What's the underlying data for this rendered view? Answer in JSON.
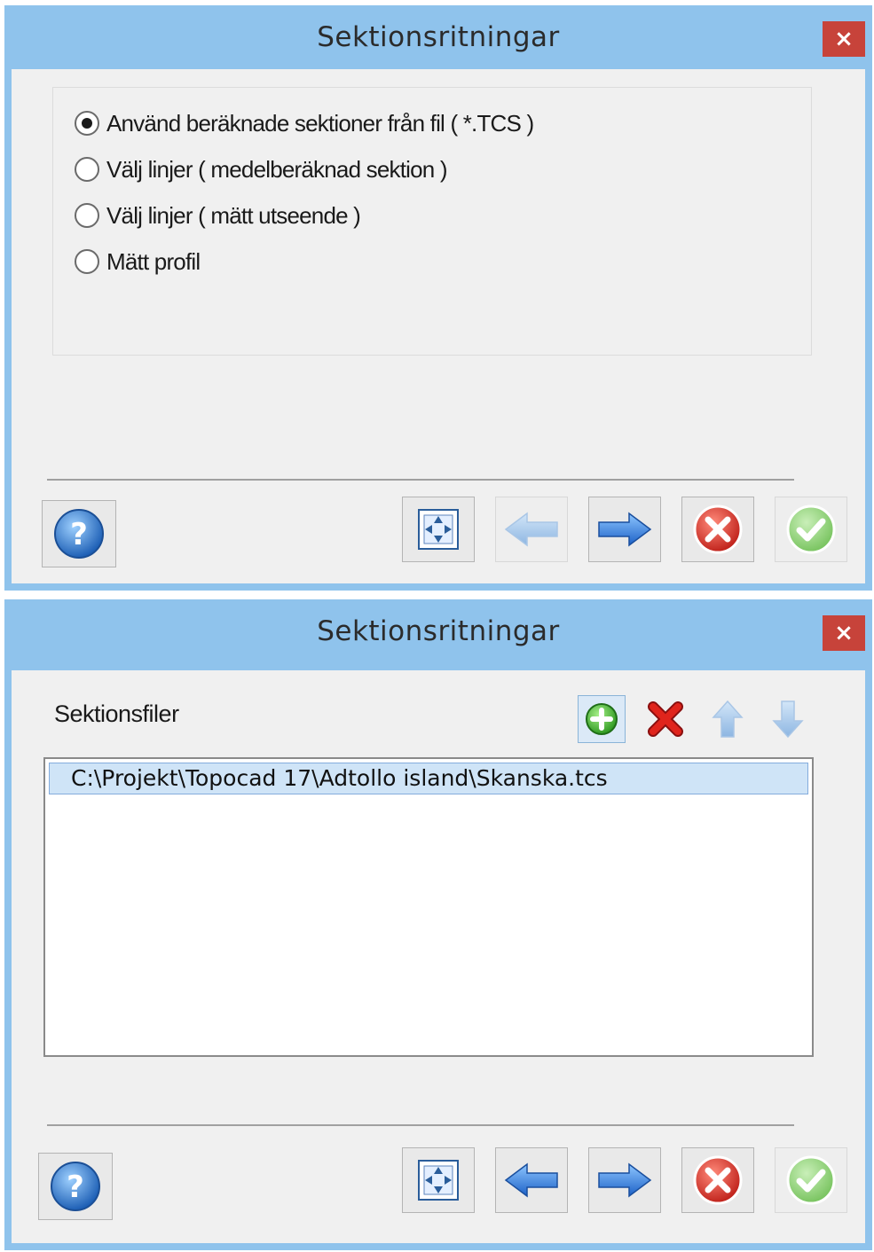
{
  "window1": {
    "title": "Sektionsritningar",
    "close_label": "×",
    "options": [
      {
        "label": "Använd beräknade sektioner från fil ( *.TCS )",
        "checked": true
      },
      {
        "label": "Välj linjer ( medelberäknad sektion )",
        "checked": false
      },
      {
        "label": "Välj linjer ( mätt utseende )",
        "checked": false
      },
      {
        "label": "Mätt profil",
        "checked": false
      }
    ],
    "buttons": {
      "help": {
        "icon": "help-icon",
        "enabled": true
      },
      "fit": {
        "icon": "zoom-extents-icon",
        "enabled": true
      },
      "back": {
        "icon": "arrow-left-icon",
        "enabled": false
      },
      "next": {
        "icon": "arrow-right-icon",
        "enabled": true
      },
      "cancel": {
        "icon": "cancel-icon",
        "enabled": true
      },
      "finish": {
        "icon": "check-icon",
        "enabled": false
      }
    }
  },
  "window2": {
    "title": "Sektionsritningar",
    "close_label": "×",
    "section_label": "Sektionsfiler",
    "toolbar": {
      "add": {
        "icon": "add-icon",
        "enabled": true
      },
      "remove": {
        "icon": "delete-icon",
        "enabled": true
      },
      "up": {
        "icon": "arrow-up-icon",
        "enabled": false
      },
      "down": {
        "icon": "arrow-down-icon",
        "enabled": false
      }
    },
    "files": [
      "C:\\Projekt\\Topocad 17\\Adtollo island\\Skanska.tcs"
    ],
    "buttons": {
      "help": {
        "icon": "help-icon",
        "enabled": true
      },
      "fit": {
        "icon": "zoom-extents-icon",
        "enabled": true
      },
      "back": {
        "icon": "arrow-left-icon",
        "enabled": true
      },
      "next": {
        "icon": "arrow-right-icon",
        "enabled": true
      },
      "cancel": {
        "icon": "cancel-icon",
        "enabled": true
      },
      "finish": {
        "icon": "check-icon",
        "enabled": false
      }
    }
  },
  "colors": {
    "window_frame": "#8fc3ec",
    "close_button": "#c7433a",
    "client_bg": "#f0f0f0",
    "selection_bg": "#cfe4f7"
  }
}
